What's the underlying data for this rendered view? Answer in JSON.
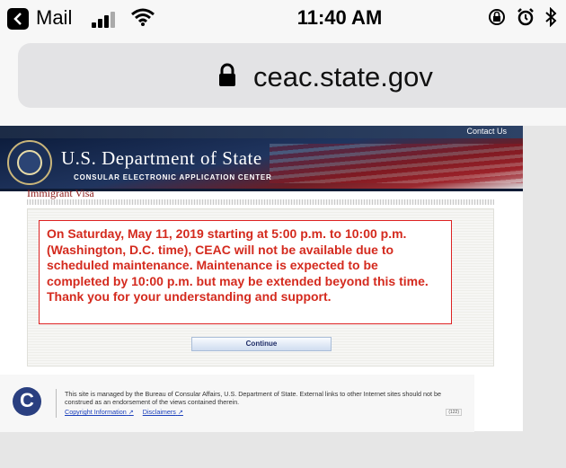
{
  "status_bar": {
    "app_name": "Mail",
    "time": "11:40 AM"
  },
  "browser": {
    "url": "ceac.state.gov"
  },
  "site": {
    "contact_link": "Contact Us",
    "dept_name": "U.S. Department of State",
    "dept_subtitle": "CONSULAR ELECTRONIC APPLICATION CENTER"
  },
  "page": {
    "section_title": "Immigrant Visa",
    "notice": "On Saturday, May 11, 2019 starting at 5:00 p.m. to 10:00 p.m. (Washington, D.C. time), CEAC will not be available due to scheduled maintenance. Maintenance is expected to be completed by 10:00 p.m. but may be extended beyond this time. Thank you for your understanding and support.",
    "continue_label": "Continue"
  },
  "footer": {
    "logo_letter": "C",
    "text": "This site is managed by the Bureau of Consular Affairs, U.S. Department of State. External links to other Internet sites should not be construed as an endorsement of the views contained therein.",
    "link_copyright": "Copyright Information",
    "link_disclaimers": "Disclaimers",
    "code": "(122)"
  },
  "icons": {
    "back": "back-arrow-icon",
    "signal": "cellular-signal-icon",
    "wifi": "wifi-icon",
    "orientation_lock": "orientation-lock-icon",
    "alarm": "alarm-icon",
    "bluetooth": "bluetooth-icon",
    "lock": "lock-icon",
    "external_link": "external-link-icon"
  },
  "colors": {
    "notice_red": "#d42a1e",
    "header_navy": "#1c2b46",
    "link_blue": "#1a3fbb"
  }
}
